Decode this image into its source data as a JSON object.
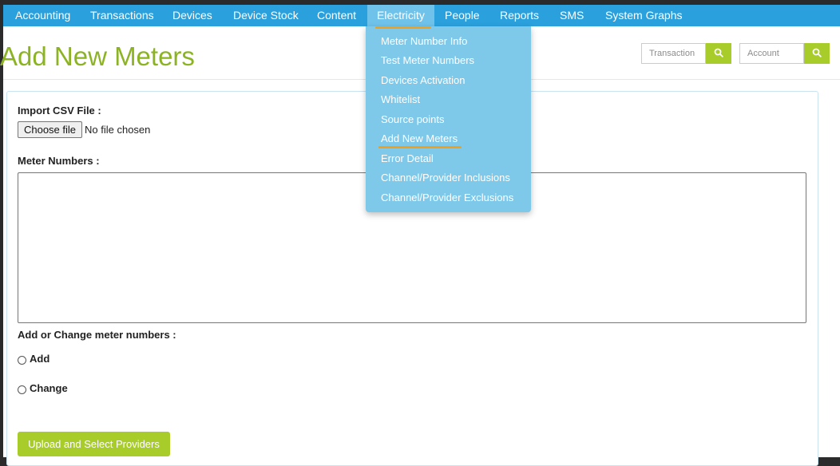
{
  "nav": {
    "items": [
      {
        "label": "Accounting"
      },
      {
        "label": "Transactions"
      },
      {
        "label": "Devices"
      },
      {
        "label": "Device Stock"
      },
      {
        "label": "Content"
      },
      {
        "label": "Electricity",
        "active": true
      },
      {
        "label": "People"
      },
      {
        "label": "Reports"
      },
      {
        "label": "SMS"
      },
      {
        "label": "System Graphs"
      }
    ]
  },
  "electricity_menu": {
    "items": [
      {
        "label": "Meter Number Info"
      },
      {
        "label": "Test Meter Numbers"
      },
      {
        "label": "Devices Activation"
      },
      {
        "label": "Whitelist"
      },
      {
        "label": "Source points"
      },
      {
        "label": "Add New Meters",
        "selected": true
      },
      {
        "label": "Error Detail"
      },
      {
        "label": "Channel/Provider Inclusions"
      },
      {
        "label": "Channel/Provider Exclusions"
      }
    ]
  },
  "page": {
    "title": "Add New Meters"
  },
  "search": {
    "transaction_placeholder": "Transaction",
    "account_placeholder": "Account",
    "icon": "search-icon"
  },
  "form": {
    "import_label": "Import CSV File :",
    "file_button_label": "Choose file",
    "file_status": "No file chosen",
    "meter_numbers_label": "Meter Numbers :",
    "meter_numbers_value": "",
    "mode_label": "Add or Change meter numbers :",
    "options": [
      {
        "label": "Add",
        "checked": false
      },
      {
        "label": "Change",
        "checked": false
      }
    ],
    "submit_label": "Upload and Select Providers"
  },
  "colors": {
    "navbar": "#2aa1dc",
    "nav_active": "#6fc3ea",
    "dropdown": "#7ec9ea",
    "accent_green": "#a8cc2a",
    "title_green": "#8cb324",
    "highlight_underline": "#f0a020"
  }
}
